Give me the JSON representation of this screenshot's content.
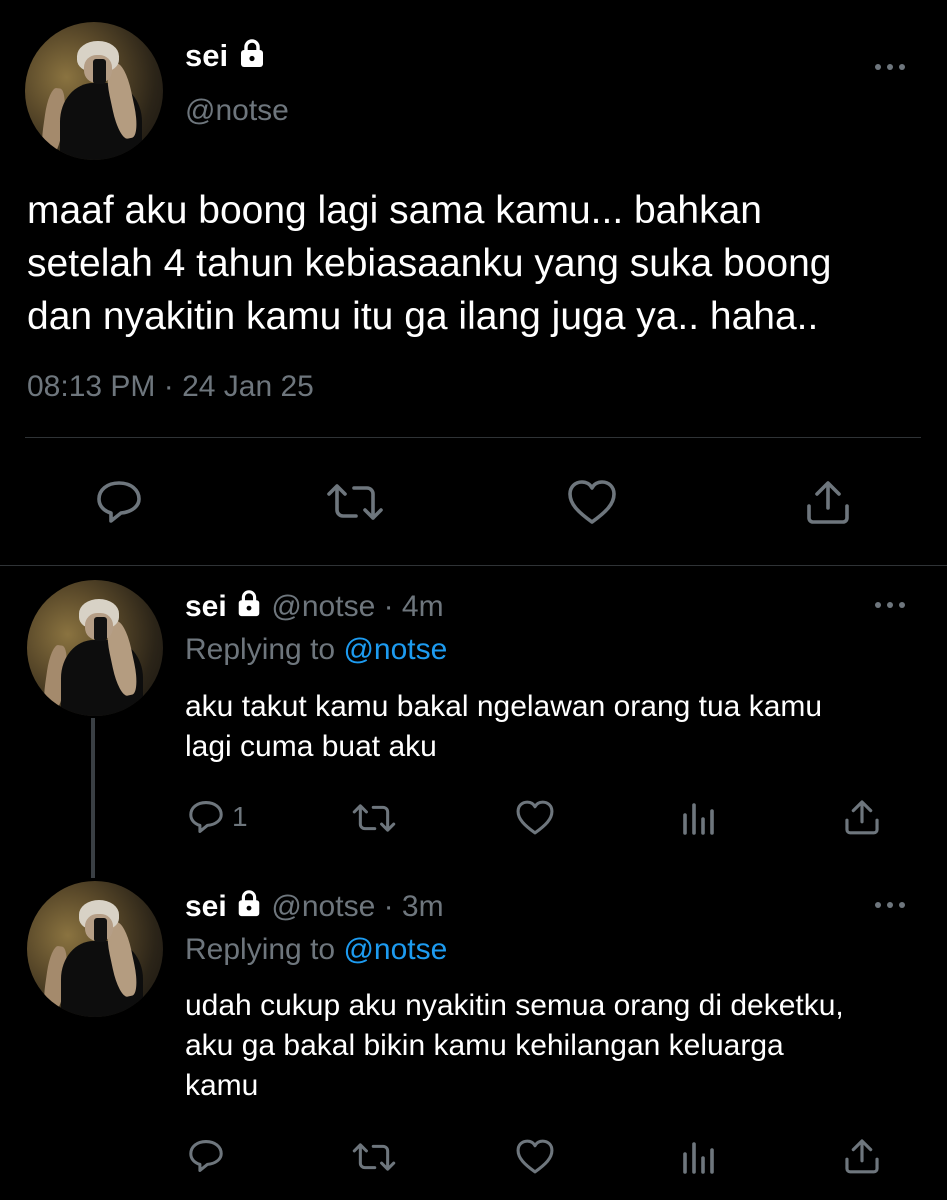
{
  "main_tweet": {
    "name": "sei",
    "handle": "@notse",
    "text_lines": [
      "maaf aku boong lagi sama kamu... bahkan",
      "setelah 4 tahun kebiasaanku yang suka boong",
      "dan nyakitin kamu itu ga ilang juga ya.. haha.."
    ],
    "timestamp": "08:13 PM · 24 Jan 25",
    "actions": [
      "reply-icon",
      "retweet-icon",
      "like-icon",
      "share-icon"
    ]
  },
  "replies": [
    {
      "name": "sei",
      "handle": "@notse",
      "time": "· 4m",
      "replying_prefix": "Replying to",
      "replying_to": "@notse",
      "text_lines": [
        "aku takut kamu bakal ngelawan orang tua kamu",
        "lagi cuma buat aku"
      ],
      "reply_count": "1"
    },
    {
      "name": "sei",
      "handle": "@notse",
      "time": "· 3m",
      "replying_prefix": "Replying to",
      "replying_to": "@notse",
      "text_lines": [
        "udah cukup aku nyakitin semua orang di deketku,",
        "aku ga bakal bikin kamu kehilangan keluarga",
        "kamu"
      ],
      "reply_count": ""
    }
  ],
  "colors": {
    "background": "#000000",
    "text": "#e7e9ea",
    "secondary": "#6e767d",
    "link": "#1d9bf0",
    "divider": "#2f3336"
  }
}
